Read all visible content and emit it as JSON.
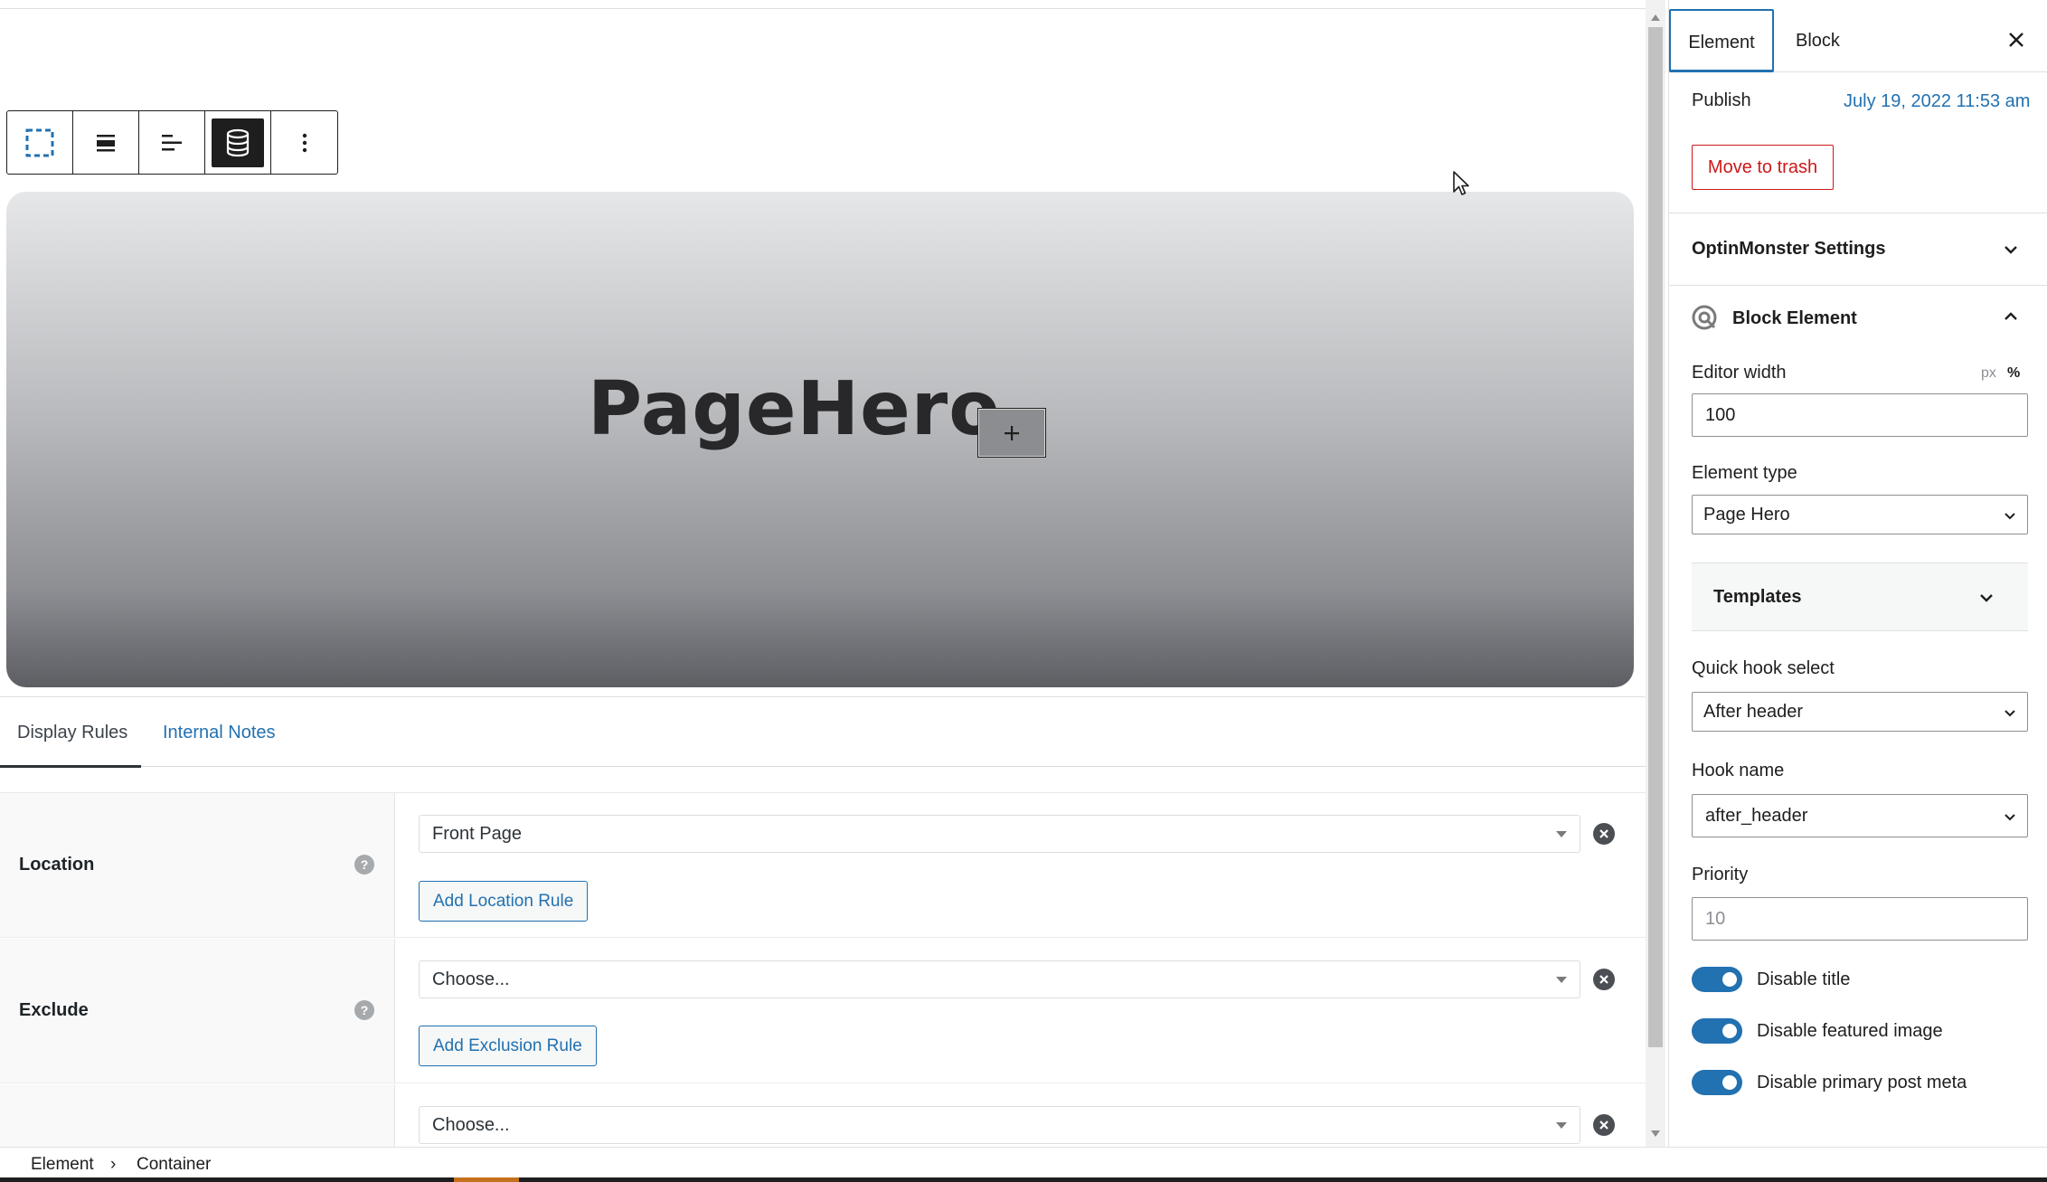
{
  "hero": {
    "title": "PageHero"
  },
  "tabs": [
    {
      "label": "Display Rules",
      "active": true
    },
    {
      "label": "Internal Notes",
      "active": false
    }
  ],
  "rules": {
    "location": {
      "label": "Location",
      "help": "?",
      "value": "Front Page",
      "add_button": "Add Location Rule"
    },
    "exclude": {
      "label": "Exclude",
      "help": "?",
      "value": "Choose...",
      "add_button": "Add Exclusion Rule"
    },
    "third": {
      "value": "Choose..."
    }
  },
  "breadcrumb": {
    "items": [
      "Element",
      "Container"
    ],
    "separator": "›"
  },
  "sidebar": {
    "tabs": [
      {
        "label": "Element",
        "active": true
      },
      {
        "label": "Block",
        "active": false
      }
    ],
    "publish_label": "Publish",
    "publish_date": "July 19, 2022 11:53 am",
    "trash_button": "Move to trash",
    "optinmonster_title": "OptinMonster Settings",
    "block_element_title": "Block Element",
    "editor_width_label": "Editor width",
    "unit_px": "px",
    "unit_percent": "%",
    "editor_width_value": "100",
    "element_type_label": "Element type",
    "element_type_value": "Page Hero",
    "templates_title": "Templates",
    "quick_hook_label": "Quick hook select",
    "quick_hook_value": "After header",
    "hook_name_label": "Hook name",
    "hook_name_value": "after_header",
    "priority_label": "Priority",
    "priority_placeholder": "10",
    "toggles": [
      {
        "label": "Disable title",
        "on": true
      },
      {
        "label": "Disable featured image",
        "on": true
      },
      {
        "label": "Disable primary post meta",
        "on": true
      }
    ]
  },
  "colors": {
    "accent": "#2271b1",
    "danger": "#cc1818",
    "text": "#1e1e1e"
  },
  "icons": [
    "select-parent-icon",
    "align-icon",
    "justify-icon",
    "database-icon",
    "more-vertical-icon",
    "plus-icon",
    "close-icon",
    "chevron-down-icon",
    "chevron-up-icon",
    "block-element-icon",
    "help-icon",
    "remove-icon"
  ]
}
